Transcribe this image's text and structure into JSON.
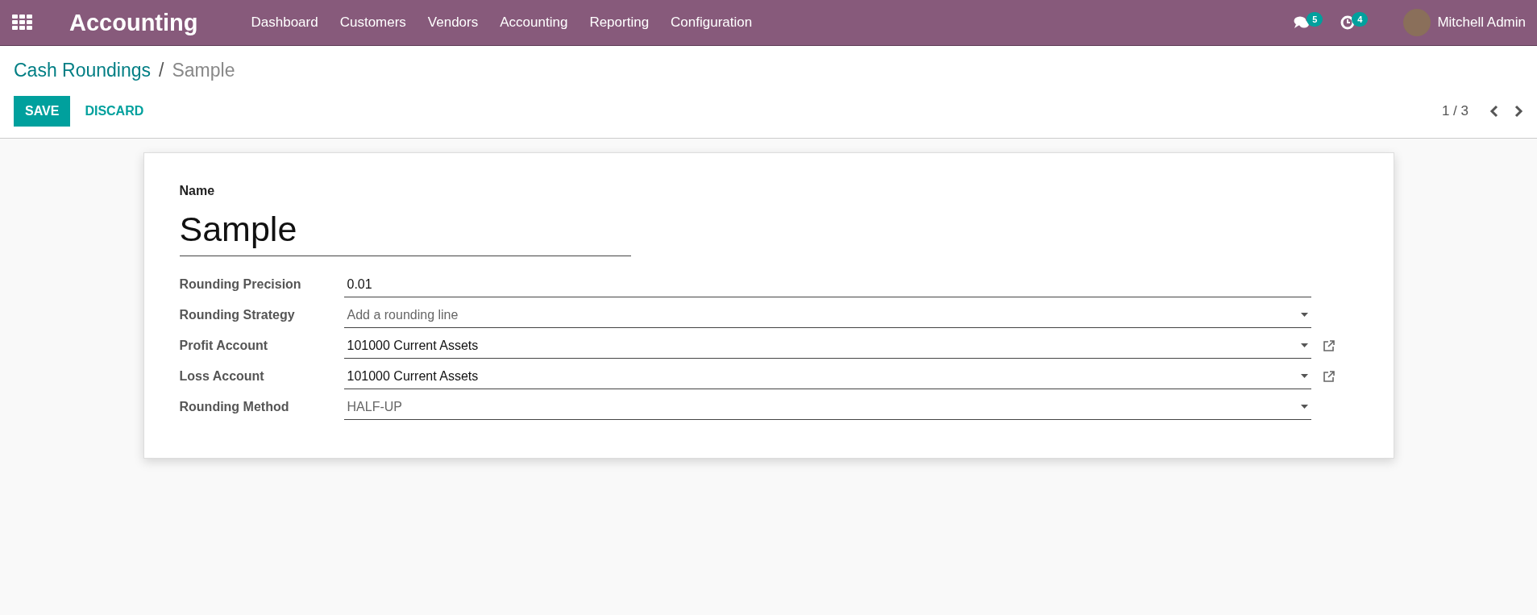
{
  "navbar": {
    "app_title": "Accounting",
    "menu": [
      {
        "label": "Dashboard"
      },
      {
        "label": "Customers"
      },
      {
        "label": "Vendors"
      },
      {
        "label": "Accounting"
      },
      {
        "label": "Reporting"
      },
      {
        "label": "Configuration"
      }
    ],
    "messages_count": "5",
    "activities_count": "4",
    "user": "Mitchell Admin"
  },
  "breadcrumb": [
    {
      "label": "Cash Roundings"
    },
    {
      "label": "Sample"
    }
  ],
  "breadcrumb_separator": "/",
  "buttons": [
    {
      "label": "SAVE",
      "kind": "primary"
    },
    {
      "label": "DISCARD",
      "kind": "link"
    }
  ],
  "pager": {
    "text": "1 / 3"
  },
  "form": {
    "name_label": "Name",
    "name_value": "Sample",
    "fields": [
      {
        "label": "Rounding Precision",
        "kind": "text",
        "value": "0.01"
      },
      {
        "label": "Rounding Strategy",
        "kind": "many2one",
        "placeholder": "Add a rounding line",
        "external_link": false
      },
      {
        "label": "Profit Account",
        "kind": "many2one",
        "value": "101000 Current Assets",
        "external_link": true
      },
      {
        "label": "Loss Account",
        "kind": "many2one",
        "value": "101000 Current Assets",
        "external_link": true
      },
      {
        "label": "Rounding Method",
        "kind": "selection",
        "value": "HALF-UP"
      }
    ]
  }
}
